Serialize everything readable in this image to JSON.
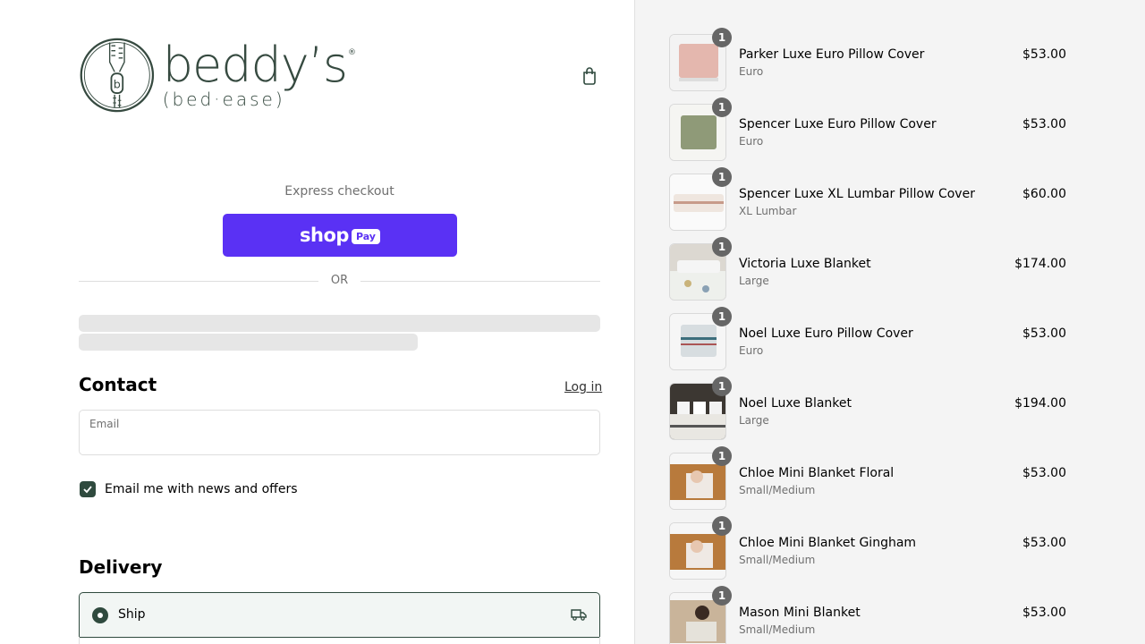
{
  "brand": {
    "name": "beddy’s",
    "tagline": "(bed·ease)",
    "reg": "®"
  },
  "express": {
    "label": "Express checkout",
    "shop_pay_text": "shop",
    "shop_pay_badge": "Pay",
    "or": "OR"
  },
  "contact": {
    "title": "Contact",
    "login": "Log in",
    "email_label": "Email",
    "email_value": "",
    "newsletter_label": "Email me with news and offers",
    "newsletter_checked": true
  },
  "delivery": {
    "title": "Delivery",
    "ship_label": "Ship"
  },
  "colors": {
    "accent": "#2f4a3e",
    "shop_pay": "#5a31f4",
    "sidebar_bg": "#f4f4f4"
  },
  "cart": {
    "items": [
      {
        "name": "Parker Luxe Euro Pillow Cover",
        "variant": "Euro",
        "price": "$53.00",
        "qty": "1",
        "thumb": "pillow-pink"
      },
      {
        "name": "Spencer Luxe Euro Pillow Cover",
        "variant": "Euro",
        "price": "$53.00",
        "qty": "1",
        "thumb": "pillow-sage"
      },
      {
        "name": "Spencer Luxe XL Lumbar Pillow Cover",
        "variant": "XL Lumbar",
        "price": "$60.00",
        "qty": "1",
        "thumb": "lumbar"
      },
      {
        "name": "Victoria Luxe Blanket",
        "variant": "Large",
        "price": "$174.00",
        "qty": "1",
        "thumb": "bed-floral"
      },
      {
        "name": "Noel Luxe Euro Pillow Cover",
        "variant": "Euro",
        "price": "$53.00",
        "qty": "1",
        "thumb": "pillow-stripe"
      },
      {
        "name": "Noel Luxe Blanket",
        "variant": "Large",
        "price": "$194.00",
        "qty": "1",
        "thumb": "bed-dark"
      },
      {
        "name": "Chloe Mini Blanket Floral",
        "variant": "Small/Medium",
        "price": "$53.00",
        "qty": "1",
        "thumb": "photo-warm"
      },
      {
        "name": "Chloe Mini Blanket Gingham",
        "variant": "Small/Medium",
        "price": "$53.00",
        "qty": "1",
        "thumb": "photo-warm"
      },
      {
        "name": "Mason Mini Blanket",
        "variant": "Small/Medium",
        "price": "$53.00",
        "qty": "1",
        "thumb": "photo-mix"
      }
    ]
  }
}
